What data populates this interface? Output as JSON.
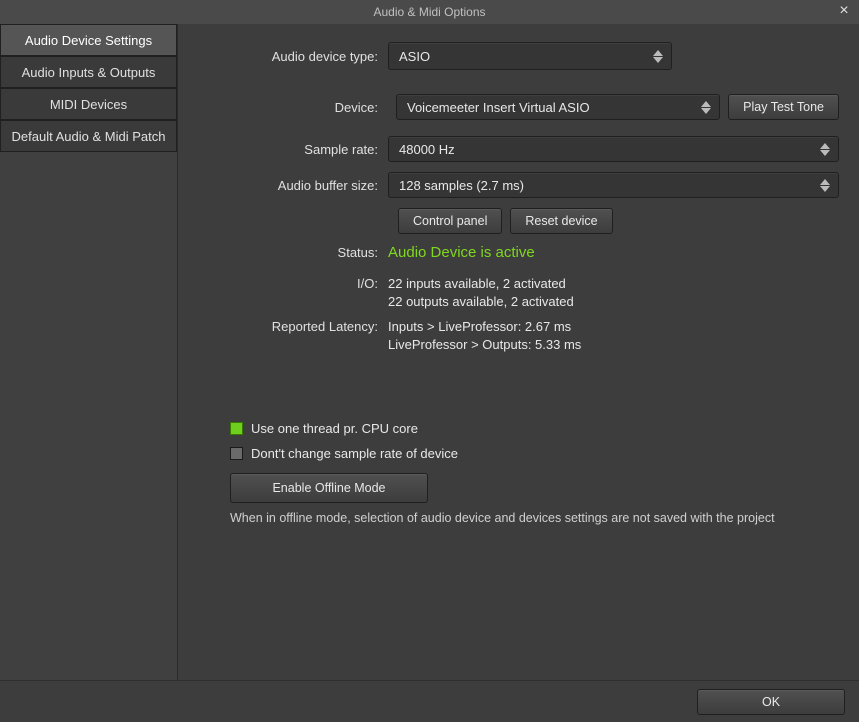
{
  "window": {
    "title": "Audio & Midi Options"
  },
  "sidebar": {
    "items": [
      {
        "label": "Audio Device Settings",
        "selected": true
      },
      {
        "label": "Audio Inputs & Outputs",
        "selected": false
      },
      {
        "label": "MIDI Devices",
        "selected": false
      },
      {
        "label": "Default Audio & Midi Patch",
        "selected": false
      }
    ]
  },
  "form": {
    "audio_device_type": {
      "label": "Audio device type:",
      "value": "ASIO"
    },
    "device": {
      "label": "Device:",
      "value": "Voicemeeter Insert Virtual ASIO"
    },
    "play_test_tone": "Play Test Tone",
    "sample_rate": {
      "label": "Sample rate:",
      "value": "48000 Hz"
    },
    "buffer_size": {
      "label": "Audio buffer size:",
      "value": "128 samples (2.7 ms)"
    },
    "control_panel": "Control panel",
    "reset_device": "Reset device",
    "status": {
      "label": "Status:",
      "value": "Audio Device is active"
    },
    "io": {
      "label": "I/O:",
      "line1": "22 inputs available, 2 activated",
      "line2": "22 outputs available, 2 activated"
    },
    "latency": {
      "label": "Reported Latency:",
      "line1": "Inputs > LiveProfessor: 2.67 ms",
      "line2": "LiveProfessor > Outputs: 5.33 ms"
    },
    "thread_checkbox": {
      "label": "Use one thread pr. CPU core",
      "checked": true
    },
    "samplerate_checkbox": {
      "label": "Dont't change sample rate of device",
      "checked": false
    },
    "offline_button": "Enable Offline Mode",
    "offline_note": "When in offline mode, selection of audio device and devices settings are not saved with the project"
  },
  "footer": {
    "ok": "OK"
  }
}
